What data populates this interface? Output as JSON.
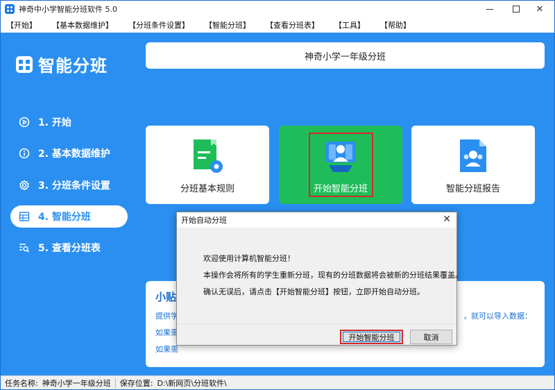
{
  "window": {
    "title": "神奇中小学智能分班软件 5.0"
  },
  "menu": [
    "【开始】",
    "【基本数据维护】",
    "【分班条件设置】",
    "【智能分班】",
    "【查看分班表】",
    "【工具】",
    "【帮助】"
  ],
  "sidebar": {
    "logo": "智能分班",
    "items": [
      {
        "label": "1. 开始",
        "icon": "play-circle-icon"
      },
      {
        "label": "2. 基本数据维护",
        "icon": "info-circle-icon"
      },
      {
        "label": "3. 分班条件设置",
        "icon": "gear-icon"
      },
      {
        "label": "4. 智能分班",
        "icon": "table-icon",
        "active": true
      },
      {
        "label": "5. 查看分班表",
        "icon": "search-list-icon"
      }
    ]
  },
  "main": {
    "header": "神奇小学一年级分班",
    "cards": [
      {
        "label": "分班基本规则",
        "icon": "rules-document-icon"
      },
      {
        "label": "开始智能分班",
        "icon": "group-start-icon"
      },
      {
        "label": "智能分班报告",
        "icon": "report-document-icon"
      }
    ],
    "tips": {
      "title": "小贴",
      "line1": "提供学",
      "line1_right": "，就可以导入数据：",
      "line2": "如果需",
      "line3": "如果需"
    }
  },
  "dialog": {
    "title": "开始自动分班",
    "lines": [
      "欢迎使用计算机智能分班！",
      "本操作会将所有的学生重新分班，现有的分班数据将会被新的分班结果覆盖。",
      "确认无误后，请点击【开始智能分班】按钮，立即开始自动分班。"
    ],
    "ok": "开始智能分班",
    "cancel": "取消"
  },
  "status": {
    "task_label": "任务名称:",
    "task_value": "神奇小学一年级分班",
    "save_label": "保存位置:",
    "save_value": "D:\\新网页\\分班软件\\"
  },
  "colors": {
    "accent": "#2a8ff0",
    "green": "#1fbd5a",
    "highlight": "#d42a2a"
  }
}
